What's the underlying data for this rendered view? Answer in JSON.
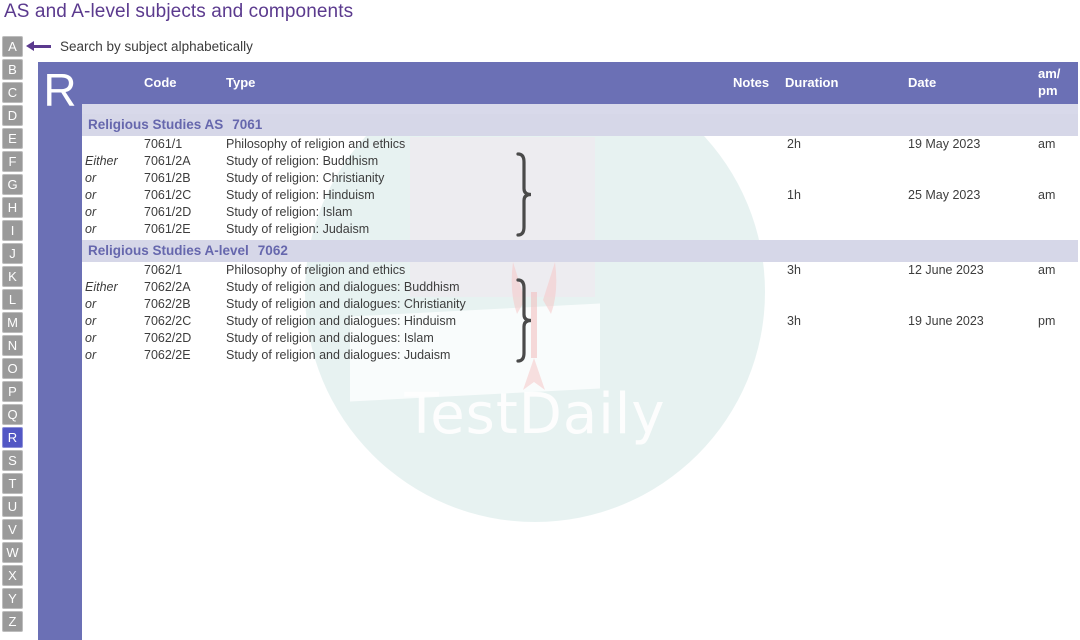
{
  "page": {
    "title": "AS and A-level subjects and components",
    "title_color": "#5b3a8e"
  },
  "search": {
    "hint_label": "Search by subject alphabetically",
    "arrow_icon": "arrow-left-icon"
  },
  "alphabet": {
    "letters": [
      "A",
      "B",
      "C",
      "D",
      "E",
      "F",
      "G",
      "H",
      "I",
      "J",
      "K",
      "L",
      "M",
      "N",
      "O",
      "P",
      "Q",
      "R",
      "S",
      "T",
      "U",
      "V",
      "W",
      "X",
      "Y",
      "Z"
    ],
    "active": "R",
    "inactive_color": "#9a9a9a",
    "active_color": "#5257c4"
  },
  "letter_panel": {
    "letter": "R",
    "background": "#6b70b5"
  },
  "watermark": {
    "text": "TestDaily",
    "circle_color": "#e3f0ee"
  },
  "table": {
    "header_background": "#6b70b5",
    "columns": {
      "either": "",
      "code": "Code",
      "type": "Type",
      "notes": "Notes",
      "duration": "Duration",
      "date": "Date",
      "ampm_line1": "am/",
      "ampm_line2": "pm"
    },
    "groups": [
      {
        "name": "Religious Studies AS",
        "code": "7061",
        "rows": [
          {
            "either": "",
            "code": "7061/1",
            "type": "Philosophy of religion and ethics",
            "notes": "",
            "duration": "2h",
            "date": "19 May 2023",
            "ampm": "am"
          },
          {
            "either": "Either",
            "code": "7061/2A",
            "type": "Study of religion: Buddhism",
            "notes": "",
            "duration": "",
            "date": "",
            "ampm": ""
          },
          {
            "either": "or",
            "code": "7061/2B",
            "type": "Study of religion: Christianity",
            "notes": "",
            "duration": "",
            "date": "",
            "ampm": ""
          },
          {
            "either": "or",
            "code": "7061/2C",
            "type": "Study of religion: Hinduism",
            "notes": "",
            "duration": "1h",
            "date": "25 May 2023",
            "ampm": "am"
          },
          {
            "either": "or",
            "code": "7061/2D",
            "type": "Study of religion: Islam",
            "notes": "",
            "duration": "",
            "date": "",
            "ampm": ""
          },
          {
            "either": "or",
            "code": "7061/2E",
            "type": "Study of religion: Judaism",
            "notes": "",
            "duration": "",
            "date": "",
            "ampm": ""
          }
        ],
        "brace": {
          "from_row": 1,
          "to_row": 5
        }
      },
      {
        "name": "Religious Studies A-level",
        "code": "7062",
        "rows": [
          {
            "either": "",
            "code": "7062/1",
            "type": "Philosophy of religion and ethics",
            "notes": "",
            "duration": "3h",
            "date": "12 June 2023",
            "ampm": "am"
          },
          {
            "either": "Either",
            "code": "7062/2A",
            "type": "Study of religion and dialogues: Buddhism",
            "notes": "",
            "duration": "",
            "date": "",
            "ampm": ""
          },
          {
            "either": "or",
            "code": "7062/2B",
            "type": "Study of religion and dialogues: Christianity",
            "notes": "",
            "duration": "",
            "date": "",
            "ampm": ""
          },
          {
            "either": "or",
            "code": "7062/2C",
            "type": "Study of religion and dialogues: Hinduism",
            "notes": "",
            "duration": "3h",
            "date": "19 June 2023",
            "ampm": "pm"
          },
          {
            "either": "or",
            "code": "7062/2D",
            "type": "Study of religion and dialogues: Islam",
            "notes": "",
            "duration": "",
            "date": "",
            "ampm": ""
          },
          {
            "either": "or",
            "code": "7062/2E",
            "type": "Study of religion and dialogues: Judaism",
            "notes": "",
            "duration": "",
            "date": "",
            "ampm": ""
          }
        ],
        "brace": {
          "from_row": 1,
          "to_row": 5
        }
      }
    ]
  }
}
